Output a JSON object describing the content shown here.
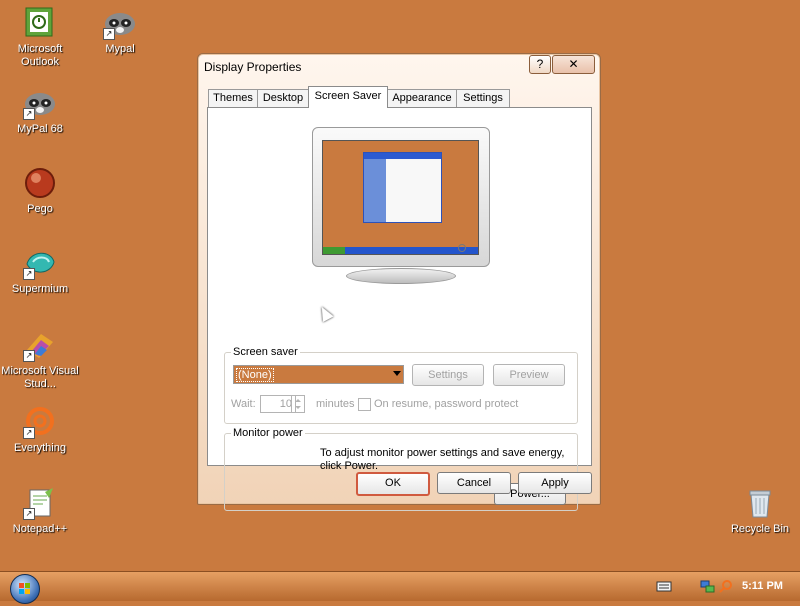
{
  "desktop": {
    "icons": [
      {
        "label": "Microsoft Outlook",
        "icon": "outlook-icon"
      },
      {
        "label": "Mypal",
        "icon": "mypal-icon"
      },
      {
        "label": "MyPal 68",
        "icon": "mypal-icon"
      },
      {
        "label": "Pego",
        "icon": "pego-icon"
      },
      {
        "label": "Supermium",
        "icon": "supermium-icon"
      },
      {
        "label": "Microsoft Visual Stud...",
        "icon": "visual-studio-icon"
      },
      {
        "label": "Everything",
        "icon": "everything-icon"
      },
      {
        "label": "Notepad++",
        "icon": "notepad-plus-plus-icon"
      },
      {
        "label": "Recycle Bin",
        "icon": "recycle-bin-icon"
      }
    ]
  },
  "dialog": {
    "title": "Display Properties",
    "help_glyph": "?",
    "close_glyph": "✕",
    "tabs": [
      {
        "label": "Themes",
        "active": false
      },
      {
        "label": "Desktop",
        "active": false
      },
      {
        "label": "Screen Saver",
        "active": true
      },
      {
        "label": "Appearance",
        "active": false
      },
      {
        "label": "Settings",
        "active": false
      }
    ],
    "screen_saver": {
      "group_label": "Screen saver",
      "selected": "(None)",
      "settings_label": "Settings",
      "preview_label": "Preview",
      "wait_label": "Wait:",
      "wait_value": "10",
      "minutes_label": "minutes",
      "resume_label": "On resume, password protect"
    },
    "monitor_power": {
      "group_label": "Monitor power",
      "text": "To adjust monitor power settings and save energy, click Power.",
      "power_label": "Power..."
    },
    "buttons": {
      "ok": "OK",
      "cancel": "Cancel",
      "apply": "Apply"
    }
  },
  "taskbar": {
    "clock": "5:11 PM",
    "tray_icons": [
      "keyboard-icon",
      "network-icon",
      "search-icon"
    ]
  },
  "colors": {
    "desktop_bg": "#c97a3f",
    "accent": "#d05a3f"
  }
}
